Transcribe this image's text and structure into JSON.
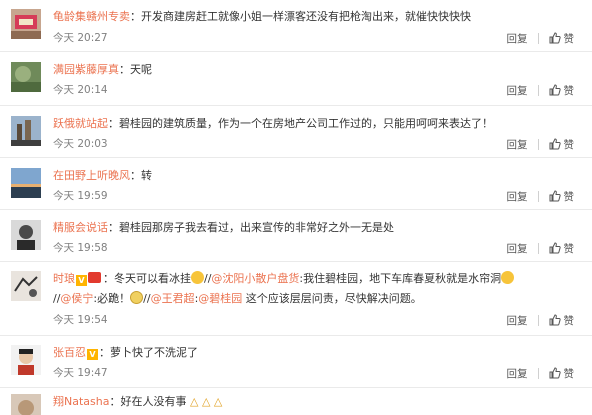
{
  "actions": {
    "reply_label": "回复",
    "like_label": "赞"
  },
  "comments": [
    {
      "username": "龟龄集赣州专卖",
      "sep": "：",
      "text": "开发商建房赶工就像小姐一样漂客还没有把枪淘出来，就催快快快快",
      "time": "今天 20:27"
    },
    {
      "username": "满园紫藤厚真",
      "sep": "：",
      "text": "天呢",
      "time": "今天 20:14"
    },
    {
      "username": "跃俄就站起",
      "sep": "：",
      "text": "碧桂园的建筑质量，作为一个在房地产公司工作过的，只能用呵呵来表达了！",
      "time": "今天 20:03"
    },
    {
      "username": "在田野上听晚风",
      "sep": "：",
      "text": "转",
      "time": "今天 19:59"
    },
    {
      "username": "精服会说话",
      "sep": "：",
      "text": "碧桂园那房子我去看过，出来宣传的非常好之外一无是处",
      "time": "今天 19:58"
    },
    {
      "username": "时琅",
      "sep": "：",
      "text_a": "冬天可以看冰挂",
      "part_b": "//",
      "at1": "@沈阳小散户盘货",
      "text_c": ":我住碧桂园，地下车库春夏秋就是水帘洞",
      "part_d": "//",
      "at2": "@侯宁",
      "text_e": ":必跪！",
      "part_f": "//",
      "at3": "@王君超",
      "sep2": ":",
      "at4": "@碧桂园",
      "text_g": " 这个应该层层问责，尽快解决问题。",
      "time": "今天 19:54"
    },
    {
      "username": "张百忍",
      "sep": "：",
      "text": "萝卜快了不洗泥了",
      "time": "今天 19:47"
    },
    {
      "username": "翔Natasha",
      "sep": "：",
      "text": "好在人没有事",
      "time": ""
    }
  ]
}
